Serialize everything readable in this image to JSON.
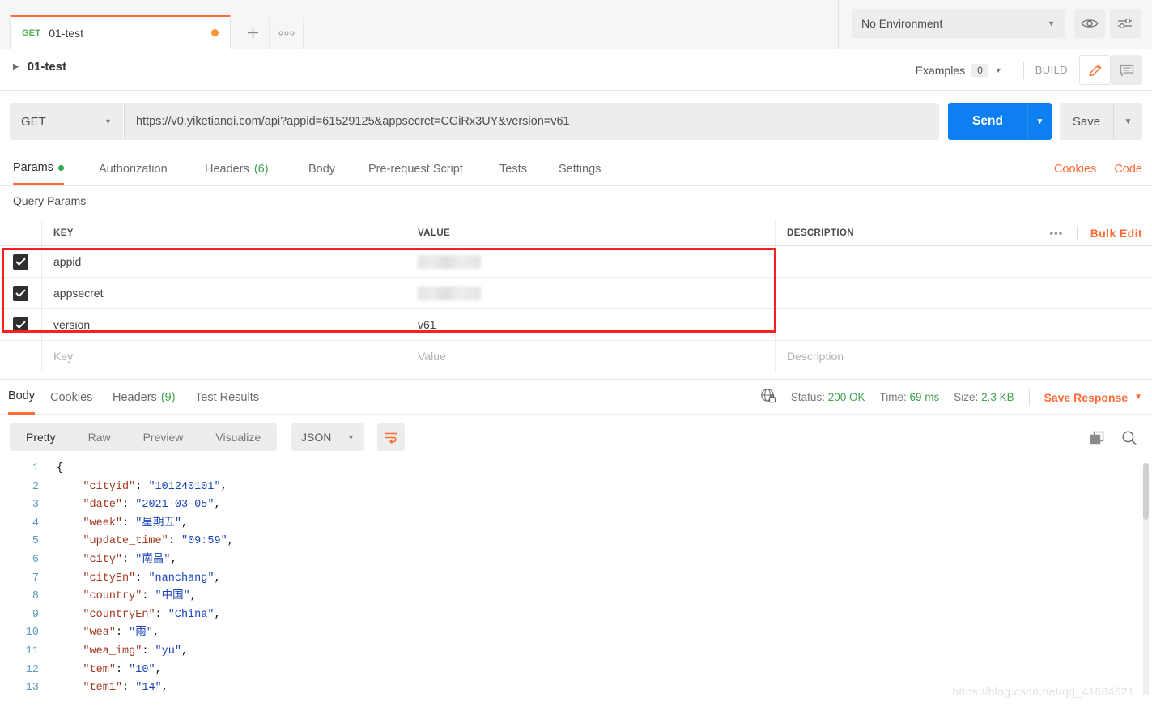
{
  "topbar": {
    "tab": {
      "method": "GET",
      "title": "01-test",
      "unsaved_dot": "unsaved"
    },
    "new_tab_label": "+",
    "tab_menu_label": "ooo",
    "environment": {
      "selected": "No Environment"
    },
    "eye_icon": "eye-icon",
    "settings_icon": "sliders-icon"
  },
  "request_header": {
    "breadcrumb_name": "01-test",
    "examples_label": "Examples",
    "examples_count": "0",
    "build_label": "BUILD",
    "edit_icon": "pencil-icon",
    "comment_icon": "comment-icon"
  },
  "url_bar": {
    "method": "GET",
    "url": "https://v0.yiketianqi.com/api?appid=61529125&appsecret=CGiRx3UY&version=v61",
    "send_label": "Send",
    "save_label": "Save"
  },
  "request_tabs": [
    {
      "label": "Params",
      "badge": "dot",
      "selected": true
    },
    {
      "label": "Authorization",
      "badge": "",
      "selected": false
    },
    {
      "label": "Headers",
      "badge": "(6)",
      "selected": false
    },
    {
      "label": "Body",
      "badge": "",
      "selected": false
    },
    {
      "label": "Pre-request Script",
      "badge": "",
      "selected": false
    },
    {
      "label": "Tests",
      "badge": "",
      "selected": false
    },
    {
      "label": "Settings",
      "badge": "",
      "selected": false
    }
  ],
  "request_tabs_right": {
    "cookies": "Cookies",
    "code": "Code"
  },
  "query_params": {
    "section_label": "Query Params",
    "columns": {
      "key": "KEY",
      "value": "VALUE",
      "description": "DESCRIPTION"
    },
    "more_label": "•••",
    "bulk_edit_label": "Bulk Edit",
    "rows": [
      {
        "checked": true,
        "key": "appid",
        "value": "",
        "value_masked": true,
        "description": ""
      },
      {
        "checked": true,
        "key": "appsecret",
        "value": "",
        "value_masked": true,
        "description": ""
      },
      {
        "checked": true,
        "key": "version",
        "value": "v61",
        "value_masked": false,
        "description": ""
      }
    ],
    "empty_row": {
      "key_placeholder": "Key",
      "value_placeholder": "Value",
      "description_placeholder": "Description"
    },
    "highlight_color": "#fb1f20"
  },
  "response": {
    "tabs": [
      {
        "label": "Body",
        "badge": "",
        "selected": true
      },
      {
        "label": "Cookies",
        "badge": "",
        "selected": false
      },
      {
        "label": "Headers",
        "badge": "(9)",
        "selected": false
      },
      {
        "label": "Test Results",
        "badge": "",
        "selected": false
      }
    ],
    "security_icon": "globe-lock-icon",
    "status_label": "Status:",
    "status_value": "200 OK",
    "time_label": "Time:",
    "time_value": "69 ms",
    "size_label": "Size:",
    "size_value": "2.3 KB",
    "save_response_label": "Save Response",
    "view_modes": [
      {
        "label": "Pretty",
        "selected": true
      },
      {
        "label": "Raw",
        "selected": false
      },
      {
        "label": "Preview",
        "selected": false
      },
      {
        "label": "Visualize",
        "selected": false
      }
    ],
    "format": "JSON",
    "wrap_icon": "word-wrap-icon",
    "copy_icon": "copy-icon",
    "search_icon": "search-icon",
    "body_lines": [
      {
        "n": "1",
        "key": "",
        "value": "",
        "text": "{"
      },
      {
        "n": "2",
        "key": "cityid",
        "value": "101240101",
        "text": ""
      },
      {
        "n": "3",
        "key": "date",
        "value": "2021-03-05",
        "text": ""
      },
      {
        "n": "4",
        "key": "week",
        "value": "星期五",
        "text": ""
      },
      {
        "n": "5",
        "key": "update_time",
        "value": "09:59",
        "text": ""
      },
      {
        "n": "6",
        "key": "city",
        "value": "南昌",
        "text": ""
      },
      {
        "n": "7",
        "key": "cityEn",
        "value": "nanchang",
        "text": ""
      },
      {
        "n": "8",
        "key": "country",
        "value": "中国",
        "text": ""
      },
      {
        "n": "9",
        "key": "countryEn",
        "value": "China",
        "text": ""
      },
      {
        "n": "10",
        "key": "wea",
        "value": "雨",
        "text": ""
      },
      {
        "n": "11",
        "key": "wea_img",
        "value": "yu",
        "text": ""
      },
      {
        "n": "12",
        "key": "tem",
        "value": "10",
        "text": ""
      },
      {
        "n": "13",
        "key": "tem1",
        "value": "14",
        "text": ""
      }
    ]
  },
  "watermark": "https://blog.csdn.net/qq_41684621",
  "colors": {
    "accent": "#ff6c37",
    "send": "#0d7ff0",
    "success": "#3fa34d",
    "highlight": "#fb1f20"
  }
}
